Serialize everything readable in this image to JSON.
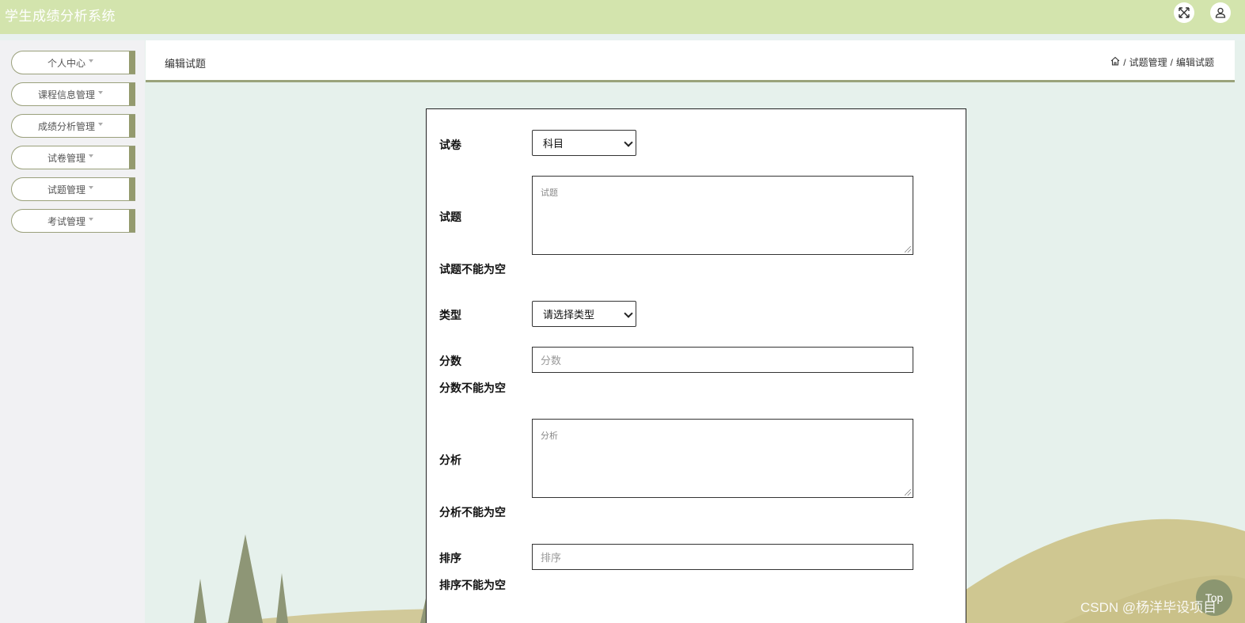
{
  "app": {
    "title": "学生成绩分析系统"
  },
  "topbar": {
    "fullscreen_icon": "expand-icon",
    "user_icon": "user-icon"
  },
  "sidebar": {
    "items": [
      {
        "label": "个人中心"
      },
      {
        "label": "课程信息管理"
      },
      {
        "label": "成绩分析管理"
      },
      {
        "label": "试卷管理"
      },
      {
        "label": "试题管理"
      },
      {
        "label": "考试管理"
      }
    ]
  },
  "header": {
    "title": "编辑试题",
    "breadcrumb": [
      "试题管理",
      "编辑试题"
    ],
    "separator": "/"
  },
  "form": {
    "paper_label": "试卷",
    "paper_value": "科目",
    "question_label": "试题",
    "question_placeholder": "试题",
    "question_error": "试题不能为空",
    "type_label": "类型",
    "type_value": "请选择类型",
    "score_label": "分数",
    "score_placeholder": "分数",
    "score_error": "分数不能为空",
    "analysis_label": "分析",
    "analysis_placeholder": "分析",
    "analysis_error": "分析不能为空",
    "order_label": "排序",
    "order_placeholder": "排序",
    "order_error": "排序不能为空"
  },
  "footer": {
    "watermark": "CSDN @杨洋毕设项目",
    "top_button": "Top"
  },
  "colors": {
    "topbar": "#d3e4ad",
    "accent": "#949a6e",
    "main_bg": "#e6f1ec"
  }
}
